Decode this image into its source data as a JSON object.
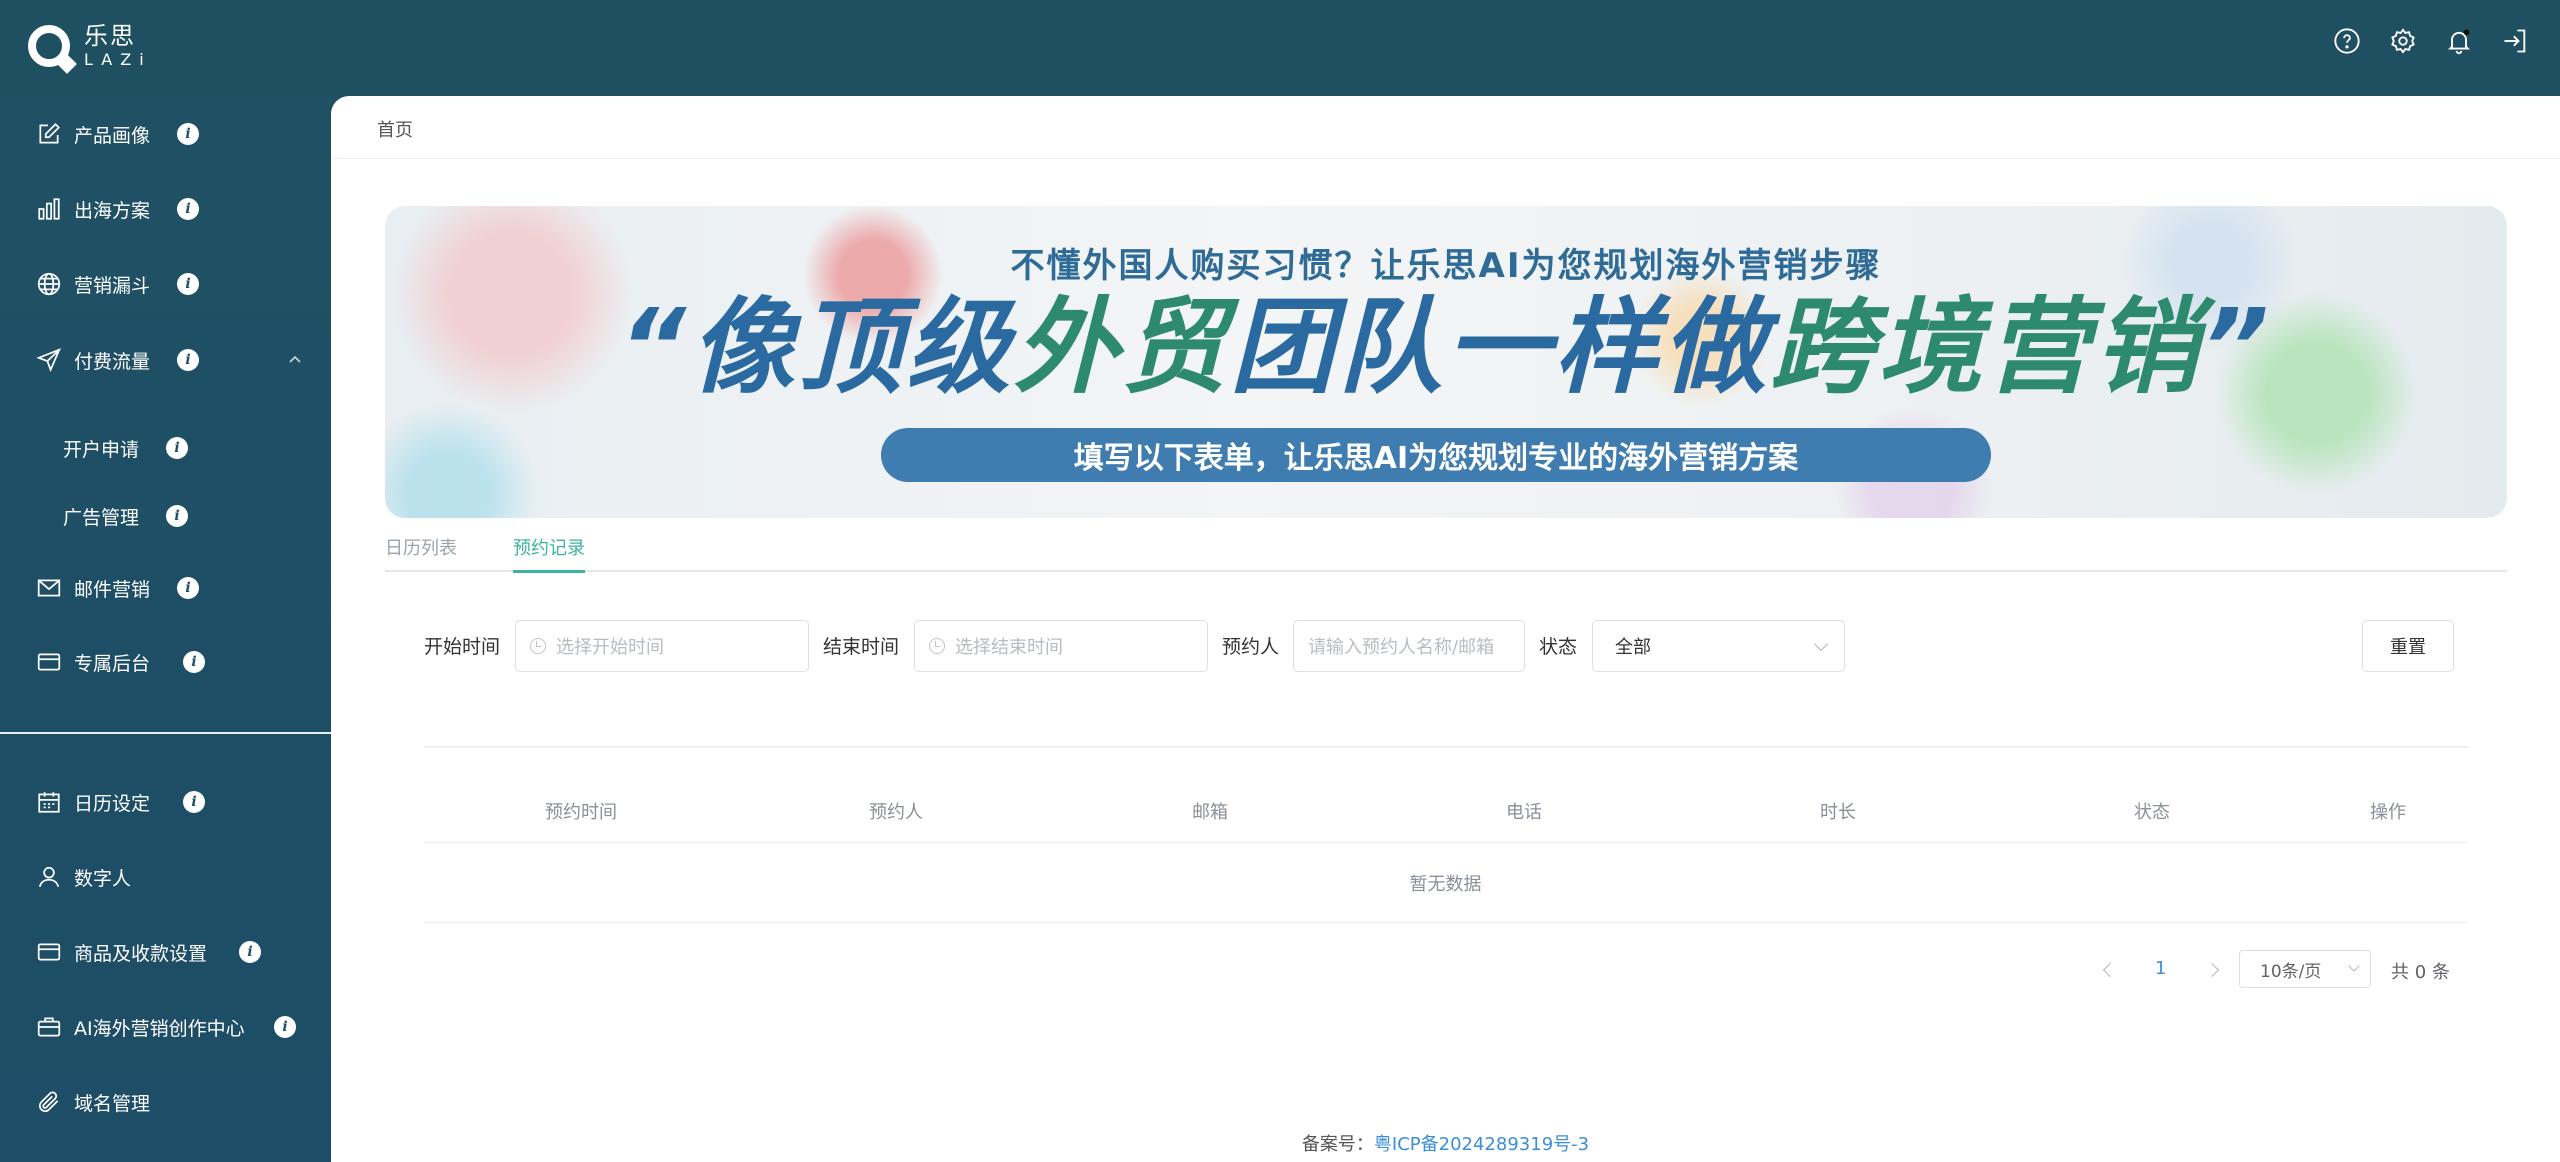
{
  "brand": {
    "cn": "乐思",
    "en": "LAZi"
  },
  "colors": {
    "sidebar": "#1f5063",
    "accent": "#3eb3a0",
    "link": "#3b8ed8"
  },
  "topbar": {
    "icons": [
      "help-icon",
      "gear-icon",
      "bell-icon",
      "logout-icon"
    ]
  },
  "sidebar": {
    "items": [
      {
        "label": "产品画像",
        "icon": "edit-icon"
      },
      {
        "label": "出海方案",
        "icon": "bar-chart-icon"
      },
      {
        "label": "营销漏斗",
        "icon": "globe-icon"
      },
      {
        "label": "付费流量",
        "icon": "send-icon"
      },
      {
        "label": "开户申请"
      },
      {
        "label": "广告管理"
      },
      {
        "label": "邮件营销",
        "icon": "mail-icon"
      },
      {
        "label": "专属后台",
        "icon": "card-icon"
      }
    ],
    "bottom_items": [
      {
        "label": "日历设定",
        "icon": "calendar-icon"
      },
      {
        "label": "数字人",
        "icon": "user-icon"
      },
      {
        "label": "商品及收款设置",
        "icon": "card-icon"
      },
      {
        "label": "AI海外营销创作中心",
        "icon": "briefcase-icon"
      },
      {
        "label": "域名管理",
        "icon": "paperclip-icon"
      }
    ],
    "info_glyph": "i"
  },
  "breadcrumb": "首页",
  "banner": {
    "sub": "不懂外国人购买习惯？让乐思AI为您规划海外营销步骤",
    "main_blue": "“像顶级",
    "main_green1": "外贸",
    "main_blue2": "团队一样做",
    "main_green2": "跨境营销",
    "main_end": "”",
    "pill": "填写以下表单，让乐思AI为您规划专业的海外营销方案"
  },
  "tabs": [
    {
      "label": "日历列表",
      "active": false
    },
    {
      "label": "预约记录",
      "active": true
    }
  ],
  "filters": {
    "start_label": "开始时间",
    "start_placeholder": "选择开始时间",
    "end_label": "结束时间",
    "end_placeholder": "选择结束时间",
    "person_label": "预约人",
    "person_placeholder": "请输入预约人名称/邮箱",
    "status_label": "状态",
    "status_value": "全部",
    "reset": "重置"
  },
  "table": {
    "columns": [
      "预约时间",
      "预约人",
      "邮箱",
      "电话",
      "时长",
      "状态",
      "操作"
    ],
    "empty_text": "暂无数据"
  },
  "pagination": {
    "current_page": "1",
    "page_size": "10条/页",
    "total": "共 0 条"
  },
  "footer": {
    "label": "备案号：",
    "icp": "粤ICP备2024289319号-3"
  }
}
